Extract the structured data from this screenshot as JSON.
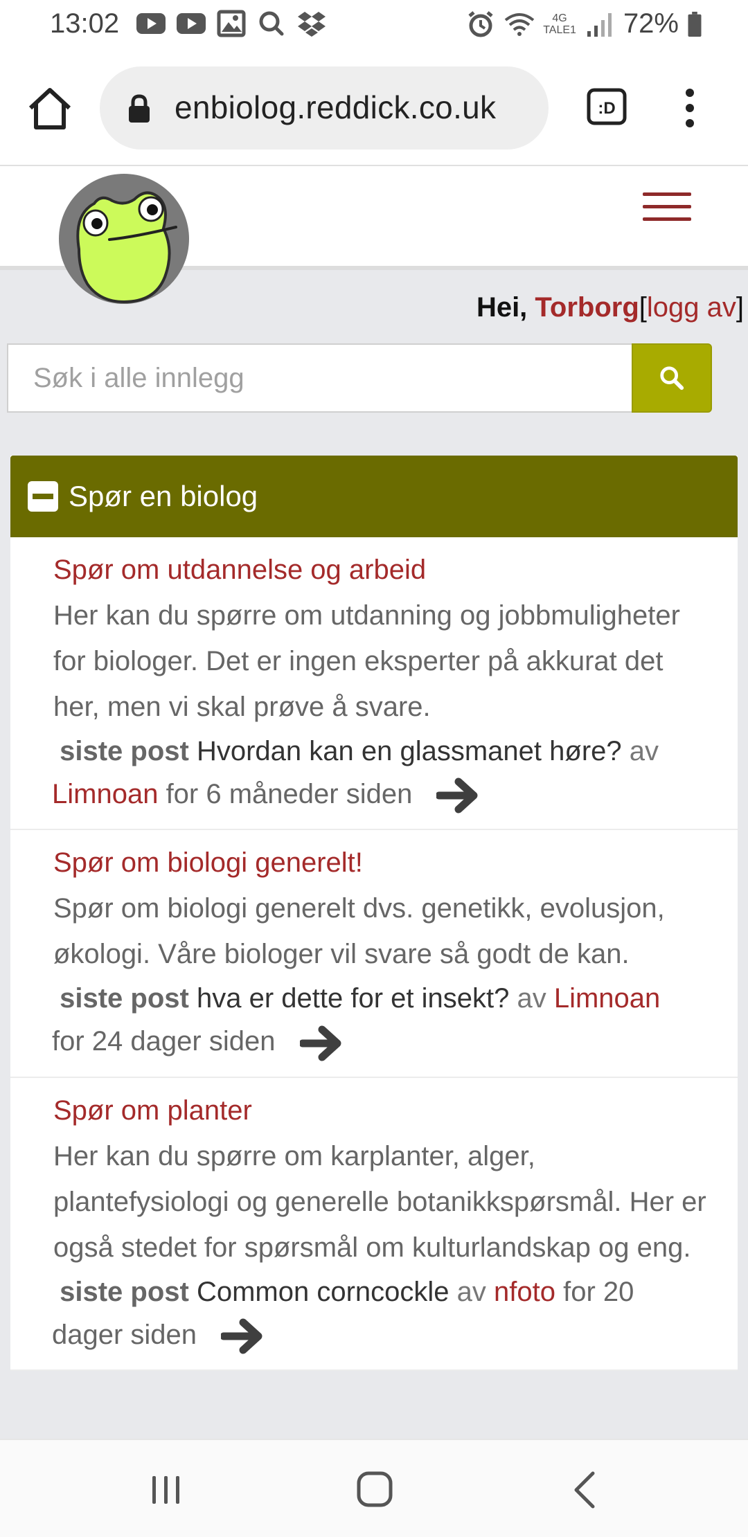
{
  "status_bar": {
    "time": "13:02",
    "left_icons": [
      "youtube-icon",
      "youtube-icon",
      "gallery-icon",
      "search-icon",
      "dropbox-icon"
    ],
    "right_icons": [
      "alarm-icon",
      "wifi-icon",
      "signal-icon",
      "battery-icon"
    ],
    "network": "4G",
    "carrier": "TALE1",
    "battery": "72%"
  },
  "browser": {
    "url": "enbiolog.reddick.co.uk",
    "tabs_icon": ":D"
  },
  "site": {
    "greeting_hei": "Hei,",
    "username": "Torborg",
    "bracket_open": "[",
    "logout": "logg av",
    "bracket_close": "]",
    "search_placeholder": "Søk i alle innlegg"
  },
  "panel": {
    "title": "Spør en biolog",
    "forums": [
      {
        "title": "Spør om utdannelse og arbeid",
        "description": "Her kan du spørre om utdanning og jobbmuligheter for biologer. Det er ingen eksperter på akkurat det her, men vi skal prøve å svare.",
        "last_label": "siste post",
        "last_post": "Hvordan kan en glassmanet høre?",
        "by": "av",
        "author": "Limnoan",
        "time": "for 6 måneder siden"
      },
      {
        "title": "Spør om biologi generelt!",
        "description": "Spør om biologi generelt dvs. genetikk, evolusjon, økologi. Våre biologer vil svare så godt de kan.",
        "last_label": "siste post",
        "last_post": "hva er dette for et insekt?",
        "by": "av",
        "author": "Limnoan",
        "time": "for 24 dager siden"
      },
      {
        "title": "Spør om planter",
        "description": "Her kan du spørre om karplanter, alger, plantefysiologi og generelle botanikkspørsmål. Her er også stedet for spørsmål om kulturlandskap og eng.",
        "last_label": "siste post",
        "last_post": "Common corncockle",
        "by": "av",
        "author": "nfoto",
        "time": "for 20 dager siden"
      }
    ]
  },
  "colors": {
    "accent_red": "#a42a2a",
    "panel_header": "#6a6b00",
    "search_button": "#a8ab00",
    "page_bg": "#e8e9ec"
  }
}
